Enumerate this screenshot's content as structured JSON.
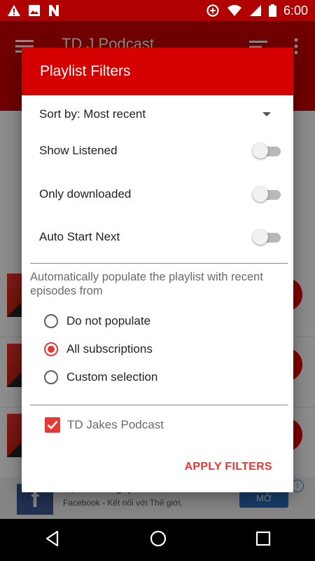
{
  "status_bar": {
    "time": "6:00",
    "icons": [
      "warning-icon",
      "image-icon",
      "n-icon",
      "data-saver-icon",
      "wifi-icon",
      "signal-icon",
      "battery-icon"
    ]
  },
  "app": {
    "title": "TD J Podcast",
    "ad": {
      "title": "Tạo ra cả ngày",
      "subtitle": "Facebook - Kết nối với Thế giới.",
      "button": "MỞ",
      "logo_letter": "f"
    }
  },
  "dialog": {
    "title": "Playlist Filters",
    "sort_label": "Sort by: Most recent",
    "toggles": [
      {
        "label": "Show Listened",
        "on": false
      },
      {
        "label": "Only downloaded",
        "on": false
      },
      {
        "label": "Auto Start Next",
        "on": false
      }
    ],
    "populate_hint": "Automatically populate the playlist with recent episodes from",
    "radios": [
      {
        "label": "Do not populate",
        "checked": false
      },
      {
        "label": "All subscriptions",
        "checked": true
      },
      {
        "label": "Custom selection",
        "checked": false
      }
    ],
    "subscription": {
      "label": "TD Jakes Podcast",
      "checked": true
    },
    "apply_label": "APPLY FILTERS"
  },
  "colors": {
    "header": "#d50000",
    "accent": "#e53935",
    "status_bar": "#b10000"
  }
}
